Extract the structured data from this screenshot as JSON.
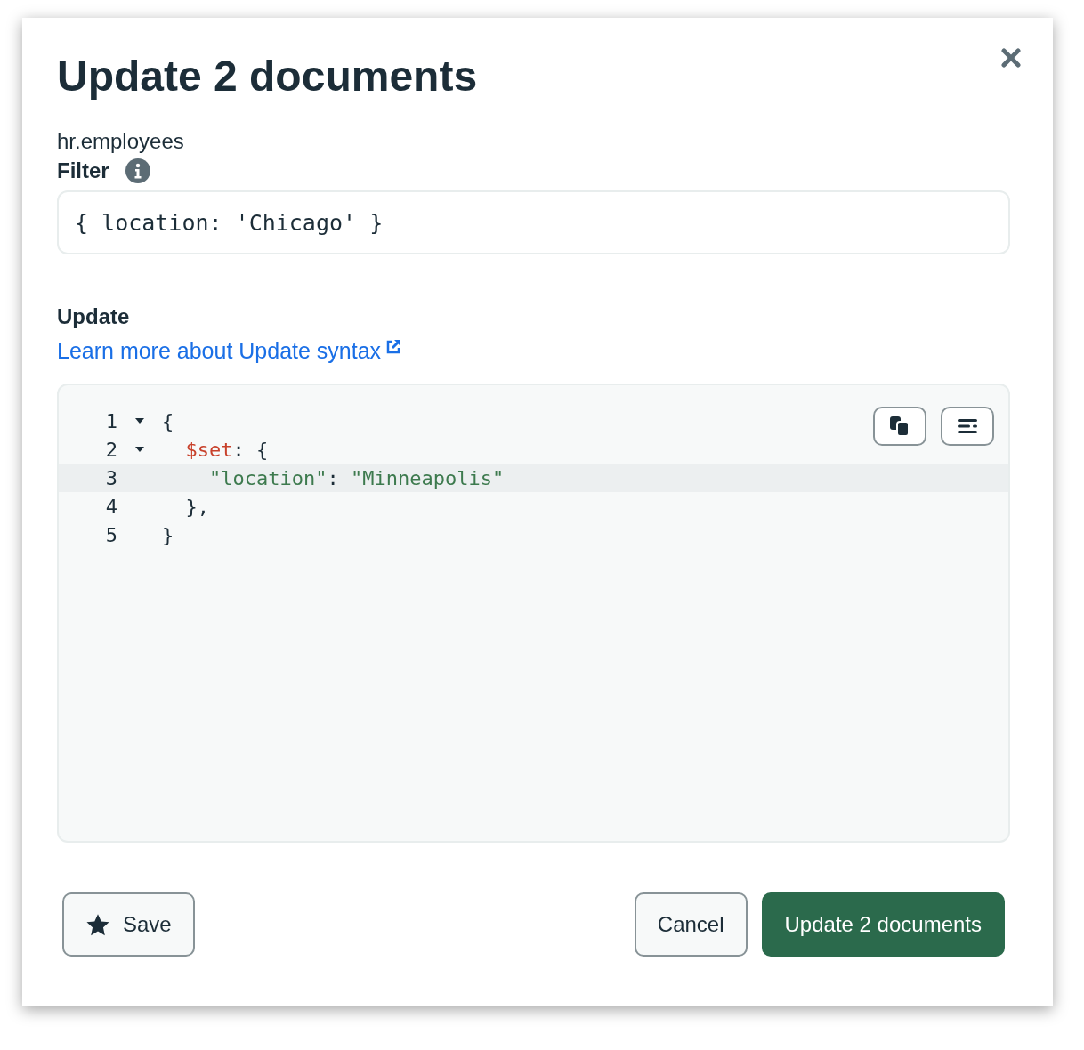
{
  "dialog": {
    "title": "Update 2 documents",
    "namespace": "hr.employees",
    "filter": {
      "label": "Filter",
      "value": "{ location: 'Chicago' }"
    },
    "update": {
      "label": "Update",
      "link": "Learn more about Update syntax",
      "lines": [
        {
          "number": "1",
          "foldable": true,
          "active": false,
          "tokens": [
            {
              "kind": "punct",
              "text": "{"
            }
          ]
        },
        {
          "number": "2",
          "foldable": true,
          "active": false,
          "tokens": [
            {
              "kind": "operator",
              "text": "  $set"
            },
            {
              "kind": "punct",
              "text": ": {"
            }
          ]
        },
        {
          "number": "3",
          "foldable": false,
          "active": true,
          "tokens": [
            {
              "kind": "string",
              "text": "    \"location\""
            },
            {
              "kind": "punct",
              "text": ": "
            },
            {
              "kind": "string",
              "text": "\"Minneapolis\""
            }
          ]
        },
        {
          "number": "4",
          "foldable": false,
          "active": false,
          "tokens": [
            {
              "kind": "punct",
              "text": "  },"
            }
          ]
        },
        {
          "number": "5",
          "foldable": false,
          "active": false,
          "tokens": [
            {
              "kind": "punct",
              "text": "}"
            }
          ]
        }
      ]
    },
    "buttons": [
      {
        "kind": "save",
        "label": "Save"
      },
      {
        "kind": "cancel",
        "label": "Cancel"
      },
      {
        "kind": "primary",
        "label": "Update 2 documents"
      }
    ]
  }
}
